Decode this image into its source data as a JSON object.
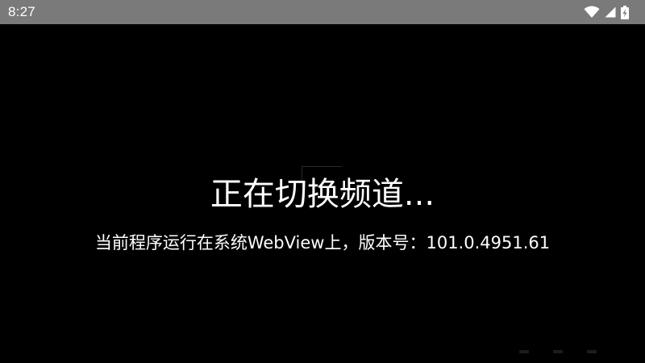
{
  "status_bar": {
    "time": "8:27",
    "icons": [
      "wifi-icon",
      "cell-signal-icon",
      "battery-charging-icon"
    ]
  },
  "screen": {
    "loading_text": "正在切换频道...",
    "webview_info": "当前程序运行在系统WebView上，版本号：101.0.4951.61"
  },
  "colors": {
    "status_bar_bg": "#7a7a7a",
    "screen_bg": "#000000",
    "text": "#ffffff"
  }
}
